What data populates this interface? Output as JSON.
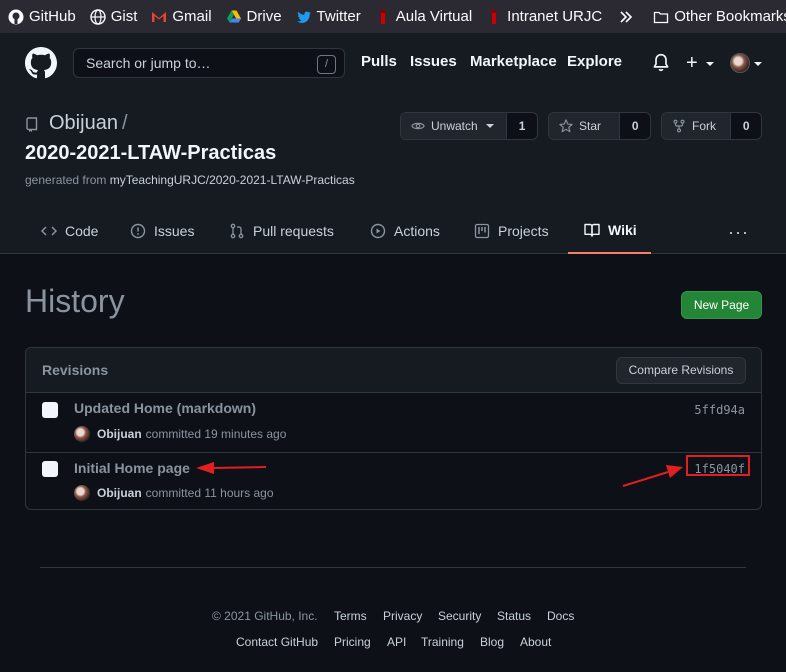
{
  "bookmarks": [
    {
      "label": "GitHub",
      "icon": "github-icon"
    },
    {
      "label": "Gist",
      "icon": "globe-icon"
    },
    {
      "label": "Gmail",
      "icon": "gmail-icon"
    },
    {
      "label": "Drive",
      "icon": "drive-icon"
    },
    {
      "label": "Twitter",
      "icon": "twitter-icon"
    },
    {
      "label": "Aula Virtual",
      "icon": "urjc-icon"
    },
    {
      "label": "Intranet URJC",
      "icon": "urjc-icon"
    },
    {
      "label": "Other Bookmarks",
      "icon": "folder-icon"
    }
  ],
  "header": {
    "search_placeholder": "Search or jump to…",
    "search_key": "/",
    "nav": [
      "Pulls",
      "Issues",
      "Marketplace",
      "Explore"
    ],
    "plus": "+"
  },
  "repo": {
    "owner": "Obijuan",
    "separator": "/",
    "name": "2020-2021-LTAW-Practicas",
    "generated_prefix": "generated from ",
    "generated_link": "myTeachingURJC/2020-2021-LTAW-Practicas",
    "watch_label": "Unwatch",
    "watch_count": "1",
    "star_label": "Star",
    "star_count": "0",
    "fork_label": "Fork",
    "fork_count": "0"
  },
  "tabs": [
    {
      "label": "Code",
      "icon": "code-icon"
    },
    {
      "label": "Issues",
      "icon": "issue-icon"
    },
    {
      "label": "Pull requests",
      "icon": "pull-request-icon"
    },
    {
      "label": "Actions",
      "icon": "play-icon"
    },
    {
      "label": "Projects",
      "icon": "project-icon"
    },
    {
      "label": "Wiki",
      "icon": "book-icon",
      "active": true
    }
  ],
  "kebab": "···",
  "page": {
    "title": "History",
    "new_page": "New Page"
  },
  "revisions": {
    "header": "Revisions",
    "compare": "Compare Revisions",
    "items": [
      {
        "title": "Updated Home (markdown)",
        "author": "Obijuan",
        "committed": "committed 19 minutes ago",
        "sha": "5ffd94a"
      },
      {
        "title": "Initial Home page",
        "author": "Obijuan",
        "committed": "committed 11 hours ago",
        "sha": "1f5040f"
      }
    ]
  },
  "footer": {
    "copyright": "© 2021 GitHub, Inc.",
    "row1": [
      "Terms",
      "Privacy",
      "Security",
      "Status",
      "Docs"
    ],
    "row2": [
      "Contact GitHub",
      "Pricing",
      "API",
      "Training",
      "Blog",
      "About"
    ]
  },
  "colors": {
    "bg": "#0d1117",
    "header": "#161b22",
    "accent_green": "#238636",
    "tab_underline": "#f78166",
    "annotation_red": "#e02020"
  }
}
